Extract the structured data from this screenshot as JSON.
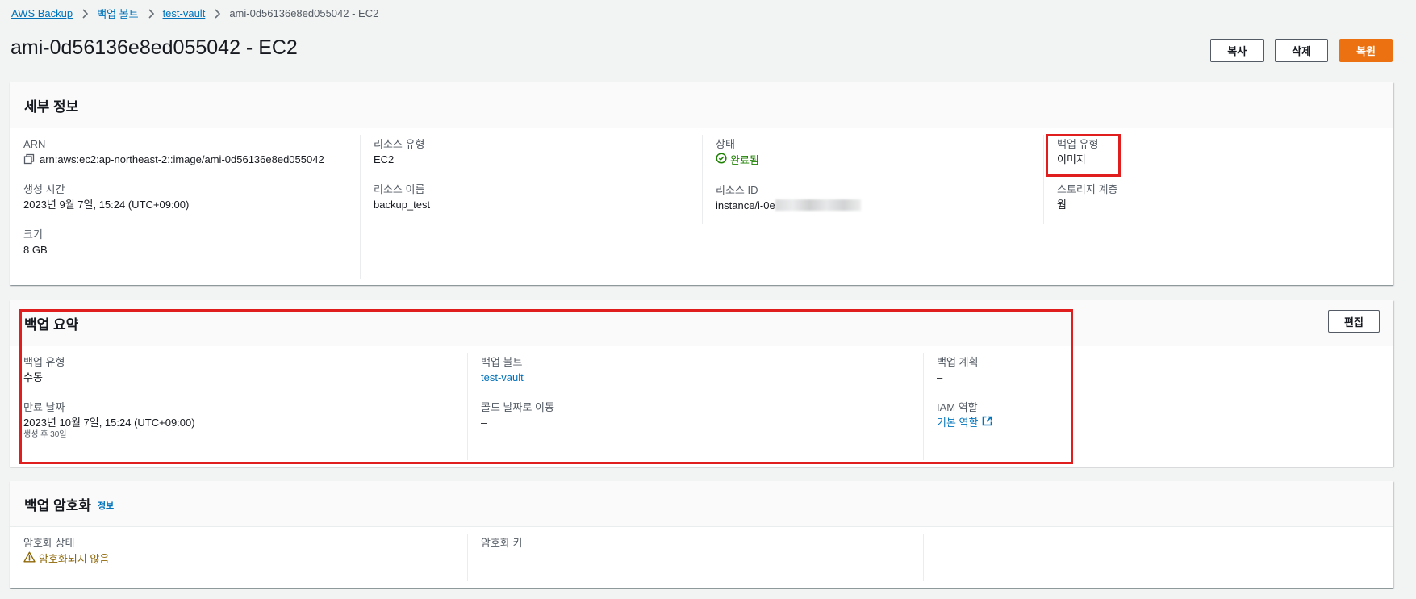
{
  "breadcrumb": {
    "items": [
      "AWS Backup",
      "백업 볼트",
      "test-vault"
    ],
    "current": "ami-0d56136e8ed055042 - EC2"
  },
  "header": {
    "title": "ami-0d56136e8ed055042 - EC2",
    "copy_label": "복사",
    "delete_label": "삭제",
    "restore_label": "복원"
  },
  "details": {
    "title": "세부 정보",
    "arn_label": "ARN",
    "arn_value": "arn:aws:ec2:ap-northeast-2::image/ami-0d56136e8ed055042",
    "created_label": "생성 시간",
    "created_value": "2023년 9월 7일, 15:24 (UTC+09:00)",
    "size_label": "크기",
    "size_value": "8 GB",
    "resource_type_label": "리소스 유형",
    "resource_type_value": "EC2",
    "resource_name_label": "리소스 이름",
    "resource_name_value": "backup_test",
    "status_label": "상태",
    "status_value": "완료됨",
    "resource_id_label": "리소스 ID",
    "resource_id_value": "instance/i-0e",
    "backup_type_label": "백업 유형",
    "backup_type_value": "이미지",
    "storage_tier_label": "스토리지 계층",
    "storage_tier_value": "웜"
  },
  "summary": {
    "title": "백업 요약",
    "edit_label": "편집",
    "backup_type_label": "백업 유형",
    "backup_type_value": "수동",
    "expiry_label": "만료 날짜",
    "expiry_value": "2023년 10월 7일, 15:24 (UTC+09:00)",
    "expiry_sub": "생성 후 30일",
    "vault_label": "백업 볼트",
    "vault_value": "test-vault",
    "cold_label": "콜드 날짜로 이동",
    "cold_value": "–",
    "plan_label": "백업 계획",
    "plan_value": "–",
    "iam_label": "IAM 역할",
    "iam_value": "기본 역할"
  },
  "encryption": {
    "title": "백업 암호화",
    "info_label": "정보",
    "status_label": "암호화 상태",
    "status_value": "암호화되지 않음",
    "key_label": "암호화 키",
    "key_value": "–"
  },
  "colors": {
    "link": "#0073bb",
    "primary": "#ec7211",
    "success": "#1d8102",
    "warning": "#8d6605",
    "highlight": "#e01e1e"
  },
  "icons": {
    "crumb_separator": "chevron-right-icon",
    "copy": "copy-icon",
    "status_ok": "check-circle-icon",
    "warning": "warning-icon",
    "external": "external-link-icon"
  }
}
